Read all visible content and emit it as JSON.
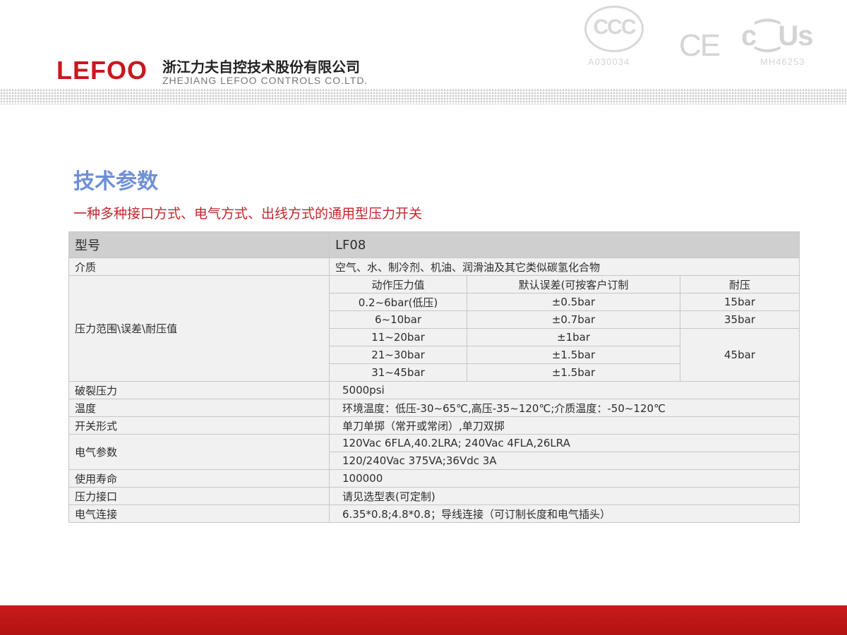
{
  "brand": {
    "logo": "LEFOO",
    "company_cn": "浙江力夫自控技术股份有限公司",
    "company_en": "ZHEJIANG LEFOO CONTROLS CO.LTD."
  },
  "certifications": {
    "ccc_code": "A030034",
    "ul_code": "MH46253",
    "ce_text": "CE",
    "ul_text": "c⁐Us"
  },
  "section_title": "技术参数",
  "subtitle": "一种多种接口方式、电气方式、出线方式的通用型压力开关",
  "table": {
    "header_label": "型号",
    "header_value": "LF08",
    "medium_label": "介质",
    "medium_value": "空气、水、制冷剂、机油、润滑油及其它类似碳氢化合物",
    "pressure_label": "压力范围\\误差\\耐压值",
    "pressure_head": [
      "动作压力值",
      "默认误差(可按客户订制",
      "耐压"
    ],
    "pressure_rows": [
      {
        "range": "0.2~6bar(低压)",
        "error": "±0.5bar",
        "proof": "15bar"
      },
      {
        "range": "6~10bar",
        "error": "±0.7bar",
        "proof": "35bar"
      },
      {
        "range": "11~20bar",
        "error": "±1bar",
        "proof": "45bar"
      },
      {
        "range": "21~30bar",
        "error": "±1.5bar"
      },
      {
        "range": "31~45bar",
        "error": "±1.5bar"
      }
    ],
    "burst_label": "破裂压力",
    "burst_value": "5000psi",
    "temp_label": "温度",
    "temp_value": "环境温度：低压-30~65℃,高压-35~120℃;介质温度：-50~120℃",
    "switch_label": "开关形式",
    "switch_value": "单刀单掷（常开或常闭）,单刀双掷",
    "electric_label": "电气参数",
    "electric_values": [
      "120Vac 6FLA,40.2LRA; 240Vac 4FLA,26LRA",
      "120/240Vac 375VA;36Vdc 3A"
    ],
    "life_label": "使用寿命",
    "life_value": "100000",
    "port_label": "压力接口",
    "port_value": "请见选型表(可定制)",
    "connection_label": "电气连接",
    "connection_value": "6.35*0.8;4.8*0.8；导线连接（可订制长度和电气插头）"
  },
  "colors": {
    "brand_red": "#c8191e",
    "title_blue": "#6f8fd6",
    "subtitle_red": "#c1272d",
    "footer_red": "#c91a1a"
  }
}
